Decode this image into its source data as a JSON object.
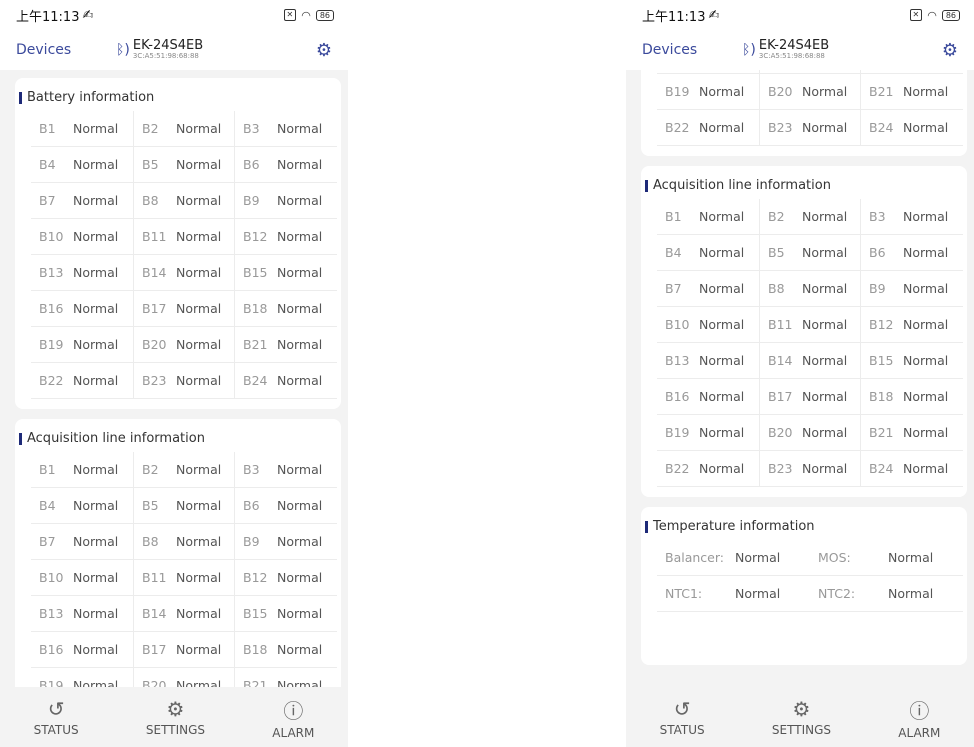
{
  "status_bar": {
    "time": "上午11:13",
    "battery": "86"
  },
  "header": {
    "devices": "Devices",
    "device_name": "EK-24S4EB",
    "device_mac": "3C:A5:51:98:68:88"
  },
  "tabs": [
    {
      "label": "STATUS",
      "icon": "history-icon"
    },
    {
      "label": "SETTINGS",
      "icon": "gear-icon"
    },
    {
      "label": "ALARM",
      "icon": "alert-circle-icon"
    }
  ],
  "left_screen": {
    "battery_title": "Battery information",
    "acq_title": "Acquisition line information"
  },
  "right_screen": {
    "acq_title": "Acquisition line information",
    "temp_title": "Temperature information",
    "temperature": [
      {
        "label": "Balancer:",
        "value": "Normal"
      },
      {
        "label": "MOS:",
        "value": "Normal"
      },
      {
        "label": "NTC1:",
        "value": "Normal"
      },
      {
        "label": "NTC2:",
        "value": "Normal"
      }
    ]
  },
  "cells": [
    {
      "label": "B1",
      "value": "Normal"
    },
    {
      "label": "B2",
      "value": "Normal"
    },
    {
      "label": "B3",
      "value": "Normal"
    },
    {
      "label": "B4",
      "value": "Normal"
    },
    {
      "label": "B5",
      "value": "Normal"
    },
    {
      "label": "B6",
      "value": "Normal"
    },
    {
      "label": "B7",
      "value": "Normal"
    },
    {
      "label": "B8",
      "value": "Normal"
    },
    {
      "label": "B9",
      "value": "Normal"
    },
    {
      "label": "B10",
      "value": "Normal"
    },
    {
      "label": "B11",
      "value": "Normal"
    },
    {
      "label": "B12",
      "value": "Normal"
    },
    {
      "label": "B13",
      "value": "Normal"
    },
    {
      "label": "B14",
      "value": "Normal"
    },
    {
      "label": "B15",
      "value": "Normal"
    },
    {
      "label": "B16",
      "value": "Normal"
    },
    {
      "label": "B17",
      "value": "Normal"
    },
    {
      "label": "B18",
      "value": "Normal"
    },
    {
      "label": "B19",
      "value": "Normal"
    },
    {
      "label": "B20",
      "value": "Normal"
    },
    {
      "label": "B21",
      "value": "Normal"
    },
    {
      "label": "B22",
      "value": "Normal"
    },
    {
      "label": "B23",
      "value": "Normal"
    },
    {
      "label": "B24",
      "value": "Normal"
    }
  ]
}
